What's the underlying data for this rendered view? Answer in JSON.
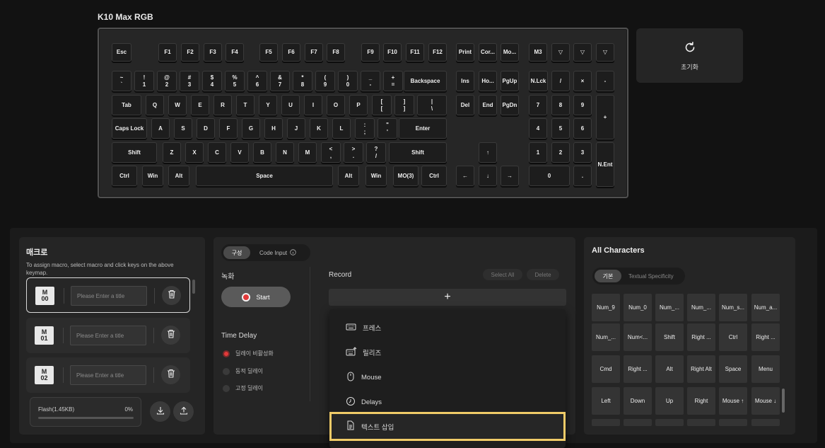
{
  "keyboard": {
    "title": "K10 Max RGB",
    "keys": [
      "Esc",
      "F1",
      "F2",
      "F3",
      "F4",
      "F5",
      "F6",
      "F7",
      "F8",
      "F9",
      "F10",
      "F11",
      "F12",
      "Print",
      "Cor...",
      "Mo...",
      "M3",
      "▽",
      "▽",
      "▽",
      "~\n`",
      "!\n1",
      "@\n2",
      "#\n3",
      "$\n4",
      "%\n5",
      "^\n6",
      "&\n7",
      "*\n8",
      "(\n9",
      ")\n0",
      "_\n-",
      "+\n=",
      "Backspace",
      "Ins",
      "Ho...",
      "PgUp",
      "N.Lck",
      "/",
      "×",
      "-",
      "Tab",
      "Q",
      "W",
      "E",
      "R",
      "T",
      "Y",
      "U",
      "I",
      "O",
      "P",
      "[\n[",
      "]\n]",
      "|\n\\",
      "Del",
      "End",
      "PgDn",
      "7",
      "8",
      "9",
      "+",
      "Caps Lock",
      "A",
      "S",
      "D",
      "F",
      "G",
      "H",
      "J",
      "K",
      "L",
      ":\n;",
      "\"\n'",
      "Enter",
      "4",
      "5",
      "6",
      "Shift",
      "Z",
      "X",
      "C",
      "V",
      "B",
      "N",
      "M",
      "<\n,",
      ">\n.",
      "?\n/",
      "Shift",
      "↑",
      "1",
      "2",
      "3",
      "N.Ent",
      "Ctrl",
      "Win",
      "Alt",
      "Space",
      "Alt",
      "Win",
      "MO(3)",
      "Ctrl",
      "←",
      "↓",
      "→",
      "0",
      "."
    ]
  },
  "reset": {
    "label": "초기화",
    "icon": "reset-icon"
  },
  "macro": {
    "title": "매크로",
    "description": "To assign macro, select macro and click keys on the above keymap.",
    "slots": [
      {
        "badge_top": "M",
        "badge_num": "00",
        "placeholder": "Please Enter a title"
      },
      {
        "badge_top": "M",
        "badge_num": "01",
        "placeholder": "Please Enter a title"
      },
      {
        "badge_top": "M",
        "badge_num": "02",
        "placeholder": "Please Enter a title"
      }
    ],
    "flash_label": "Flash(1.45KB)",
    "flash_percent": "0%",
    "flash_fill": 0
  },
  "editor": {
    "tab_active": "구성",
    "tab_other": "Code Input",
    "record_section": "녹화",
    "start_label": "Start",
    "time_delay_title": "Time Delay",
    "delay_options": [
      "딜레이 비활성화",
      "동적 딜레이",
      "고정 딜레이"
    ],
    "record_title": "Record",
    "select_all": "Select All",
    "delete": "Delete",
    "add": "+"
  },
  "dropdown": {
    "items": [
      {
        "label": "프레스",
        "icon": "keyboard-press-icon"
      },
      {
        "label": "릴리즈",
        "icon": "keyboard-release-icon"
      },
      {
        "label": "Mouse",
        "icon": "mouse-icon"
      },
      {
        "label": "Delays",
        "icon": "clock-icon"
      },
      {
        "label": "텍스트 삽입",
        "icon": "document-icon"
      }
    ]
  },
  "characters": {
    "title": "All Characters",
    "tab_active": "기본",
    "tab_other": "Textual Specificity",
    "keys": [
      "Num_9",
      "Num_0",
      "Num_...",
      "Num_...",
      "Num_s...",
      "Num_a...",
      "Num_...",
      "Num<...",
      "Shift",
      "Right ...",
      "Ctrl",
      "Right ...",
      "Cmd",
      "Right ...",
      "Alt",
      "Right Alt",
      "Space",
      "Menu",
      "Left",
      "Down",
      "Up",
      "Right",
      "Mouse ↑",
      "Mouse ↓"
    ]
  },
  "colors": {
    "accent_red": "#e23a3a",
    "highlight": "#f0cb68"
  }
}
